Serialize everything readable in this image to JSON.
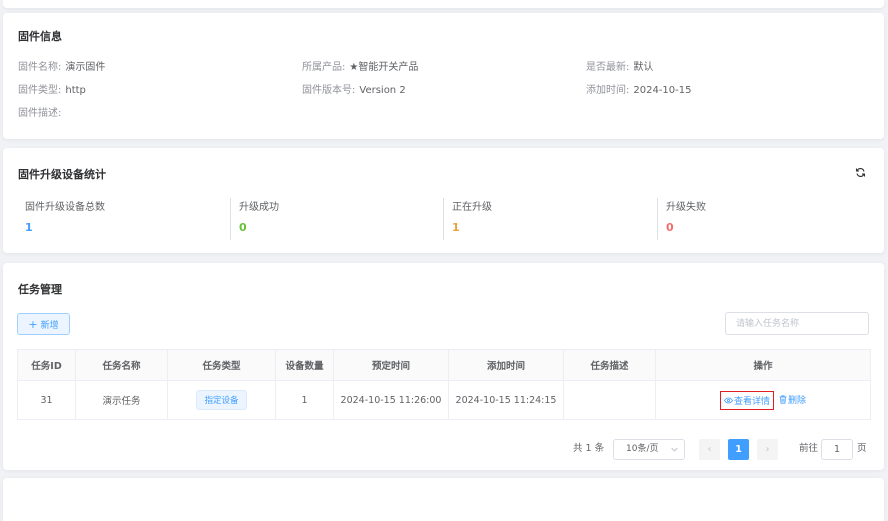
{
  "firmware_info": {
    "title": "固件信息",
    "fields": [
      {
        "label": "固件名称:",
        "value": "演示固件"
      },
      {
        "label": "所属产品:",
        "value": "★智能开关产品"
      },
      {
        "label": "是否最新:",
        "value": "默认"
      },
      {
        "label": "固件类型:",
        "value": "http"
      },
      {
        "label": "固件版本号:",
        "value": "Version 2"
      },
      {
        "label": "添加时间:",
        "value": "2024-10-15"
      },
      {
        "label": "固件描述:",
        "value": ""
      }
    ]
  },
  "upgrade_stats": {
    "title": "固件升级设备统计",
    "refresh_icon": "refresh-icon",
    "items": [
      {
        "label": "固件升级设备总数",
        "value": "1",
        "color": "#409eff"
      },
      {
        "label": "升级成功",
        "value": "0",
        "color": "#67c23a"
      },
      {
        "label": "正在升级",
        "value": "1",
        "color": "#e6a23c"
      },
      {
        "label": "升级失败",
        "value": "0",
        "color": "#f56c6c"
      }
    ]
  },
  "task_management": {
    "title": "任务管理",
    "add_button": "新增",
    "search_placeholder": "请输入任务名称",
    "table": {
      "columns": [
        "任务ID",
        "任务名称",
        "任务类型",
        "设备数量",
        "预定时间",
        "添加时间",
        "任务描述",
        "操作"
      ],
      "rows": [
        {
          "id": "31",
          "name": "演示任务",
          "type": "指定设备",
          "device_count": "1",
          "scheduled_time": "2024-10-15 11:26:00",
          "added_time": "2024-10-15 11:24:15",
          "description": "",
          "view_action": "查看详情",
          "delete_action": "删除"
        }
      ]
    },
    "pagination": {
      "total": "共 1 条",
      "page_size": "10条/页",
      "prev": "‹",
      "current_page": "1",
      "next": "›",
      "goto_prefix": "前往",
      "goto_value": "1",
      "goto_suffix": "页"
    }
  },
  "colors": {
    "primary": "#409eff",
    "success": "#67c23a",
    "warning": "#e6a23c",
    "danger": "#f56c6c",
    "highlight_border": "#e02020"
  }
}
